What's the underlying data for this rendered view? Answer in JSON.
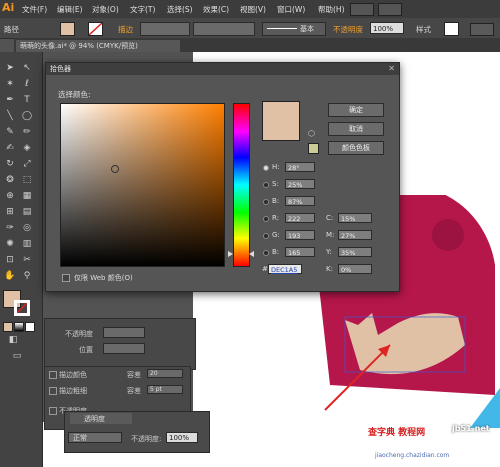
{
  "app": {
    "logo": "Ai",
    "menus": [
      "文件(F)",
      "编辑(E)",
      "对象(O)",
      "文字(T)",
      "选择(S)",
      "效果(C)",
      "视图(V)",
      "窗口(W)",
      "帮助(H)"
    ]
  },
  "control_bar": {
    "path_label": "路径",
    "stroke_label": "描边",
    "stroke_style": "基本",
    "opacity_label": "不透明度",
    "opacity_value": "100%",
    "style_label": "样式",
    "fill_color": "#e0c1a6"
  },
  "document": {
    "tab_title": "萌萌的头像.ai* @ 94% (CMYK/预览)"
  },
  "color_picker": {
    "title": "拾色器",
    "select_label": "选择颜色:",
    "ok_label": "确定",
    "cancel_label": "取消",
    "swatches_label": "颜色色板",
    "hsb": [
      {
        "label": "H:",
        "value": "28°"
      },
      {
        "label": "S:",
        "value": "25%"
      },
      {
        "label": "B:",
        "value": "87%"
      }
    ],
    "rgb": [
      {
        "label": "R:",
        "value": "222"
      },
      {
        "label": "G:",
        "value": "193"
      },
      {
        "label": "B:",
        "value": "165"
      }
    ],
    "cmyk": [
      {
        "label": "C:",
        "value": "15%"
      },
      {
        "label": "M:",
        "value": "27%"
      },
      {
        "label": "Y:",
        "value": "35%"
      },
      {
        "label": "K:",
        "value": "0%"
      }
    ],
    "hex_label": "#",
    "hex_value": "DEC1A5",
    "web_only_label": "仅限 Web 颜色(O)",
    "current_color": "#e0c1a6"
  },
  "panels": {
    "opacity_label": "不透明度",
    "position_label": "位置",
    "stroke_color_label": "描边颜色",
    "stroke_weight_label": "描边粗细",
    "capacity_label": "容差",
    "capacity_value1": "20",
    "capacity_value2": "5 pt",
    "nontransparent_label": "不透明度",
    "transparency_tab": "透明度",
    "blend_mode": "正常",
    "transparency_opacity_label": "不透明度:",
    "transparency_opacity_value": "100%"
  },
  "artwork": {
    "face_color": "#e0c1a6",
    "hair_color": "#b5174a",
    "arrow_color": "#e02424"
  },
  "watermark": {
    "line1": "查字典 教程网",
    "line2": "jiaocheng.chazidian.com",
    "site": "jb51.net"
  }
}
